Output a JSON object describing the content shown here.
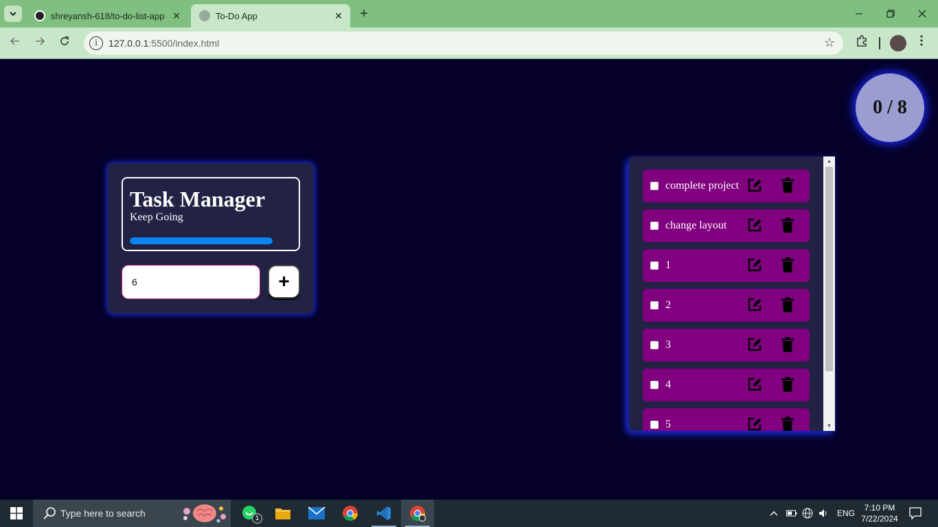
{
  "browser": {
    "tabs": [
      {
        "title": "shreyansh-618/to-do-list-app",
        "active": false
      },
      {
        "title": "To-Do App",
        "active": true
      }
    ],
    "url_host": "127.0.0.1",
    "url_rest": ":5500/index.html"
  },
  "app": {
    "counter": "0 / 8",
    "title": "Task Manager",
    "subtitle": "Keep Going",
    "progress_fraction": 0.0,
    "input_value": "6",
    "add_button_label": "+",
    "tasks": [
      {
        "text": "complete project",
        "done": false
      },
      {
        "text": "change layout",
        "done": false
      },
      {
        "text": "1",
        "done": false
      },
      {
        "text": "2",
        "done": false
      },
      {
        "text": "3",
        "done": false
      },
      {
        "text": "4",
        "done": false
      },
      {
        "text": "5",
        "done": false
      }
    ],
    "colors": {
      "page_bg": "#050029",
      "card_bg": "#222244",
      "task_bg": "#800080",
      "accent_glow": "#1b2bd9",
      "progress": "#0a84f0",
      "counter_bg": "#9b9ccf"
    }
  },
  "taskbar": {
    "search_placeholder": "Type here to search",
    "whatsapp_badge": "1",
    "language": "ENG",
    "time": "7:10 PM",
    "date": "7/22/2024",
    "apps": [
      "windows-start-icon",
      "whatsapp-icon",
      "file-explorer-icon",
      "mail-icon",
      "chrome-icon",
      "vscode-icon",
      "chrome-profile-icon"
    ]
  }
}
